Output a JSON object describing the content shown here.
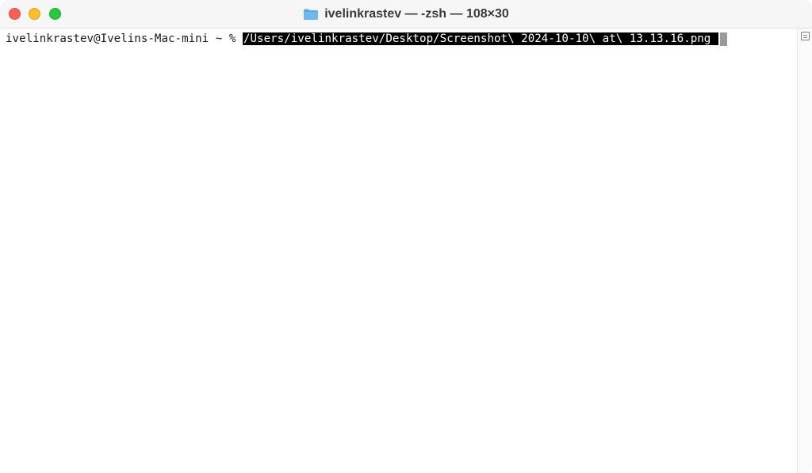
{
  "window": {
    "title": "ivelinkrastev — -zsh — 108×30",
    "folder_icon": "folder-icon"
  },
  "terminal": {
    "prompt": "ivelinkrastev@Ivelins-Mac-mini ~ % ",
    "command": "/Users/ivelinkrastev/Desktop/Screenshot\\ 2024-10-10\\ at\\ 13.13.16.png "
  },
  "colors": {
    "close": "#ff5f57",
    "minimize": "#febc2e",
    "zoom": "#28c840",
    "selection_bg": "#000000",
    "selection_fg": "#ffffff"
  }
}
